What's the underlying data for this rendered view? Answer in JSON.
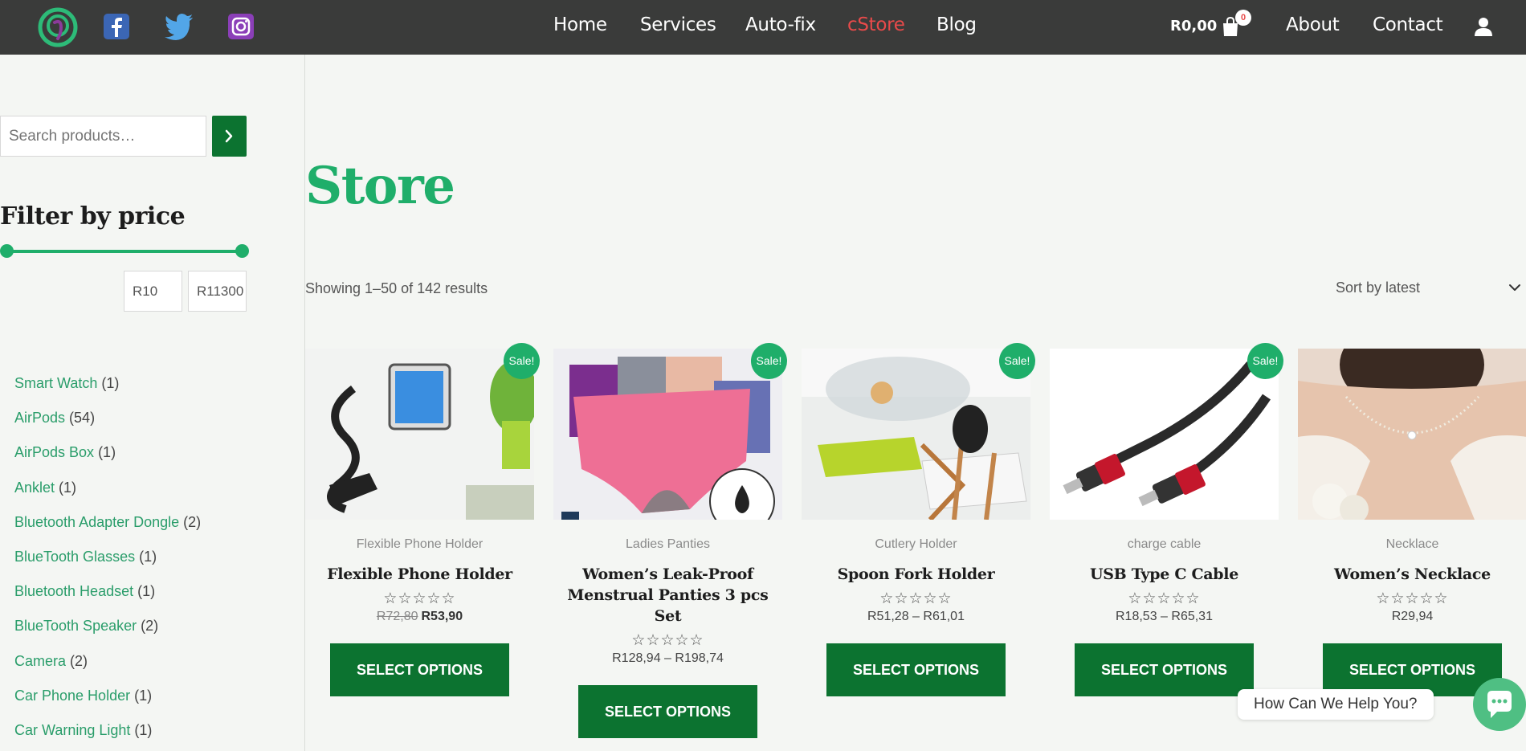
{
  "header": {
    "nav": [
      {
        "label": "Home"
      },
      {
        "label": "Services"
      },
      {
        "label": "Auto-fix"
      },
      {
        "label": "cStore"
      },
      {
        "label": "Blog"
      },
      {
        "label": "About"
      },
      {
        "label": "Contact"
      }
    ],
    "active_nav": "cStore",
    "cart_total": "R0,00",
    "cart_count": "0",
    "social": [
      "facebook-icon",
      "twitter-icon",
      "instagram-icon"
    ]
  },
  "sidebar": {
    "search_placeholder": "Search products…",
    "filter_title": "Filter by price",
    "price_min": "R10",
    "price_max": "R11300",
    "categories": [
      {
        "name": "Smart Watch",
        "count": "(1)"
      },
      {
        "name": "AirPods",
        "count": "(54)"
      },
      {
        "name": "AirPods Box",
        "count": "(1)"
      },
      {
        "name": "Anklet",
        "count": "(1)"
      },
      {
        "name": "Bluetooth Adapter Dongle",
        "count": "(2)"
      },
      {
        "name": "BlueTooth Glasses",
        "count": "(1)"
      },
      {
        "name": "Bluetooth Headset",
        "count": "(1)"
      },
      {
        "name": "BlueTooth Speaker",
        "count": "(2)"
      },
      {
        "name": "Camera",
        "count": "(2)"
      },
      {
        "name": "Car Phone Holder",
        "count": "(1)"
      },
      {
        "name": "Car Warning Light",
        "count": "(1)"
      }
    ]
  },
  "main": {
    "title": "Store",
    "result_count": "Showing 1–50 of 142 results",
    "sort_label": "Sort by latest",
    "sale_label": "Sale!",
    "stars": "☆☆☆☆☆",
    "button_label": "SELECT OPTIONS",
    "products": [
      {
        "category": "Flexible Phone Holder",
        "title": "Flexible Phone Holder",
        "old_price": "R72,80",
        "price": "R53,90",
        "sale": true
      },
      {
        "category": "Ladies Panties",
        "title": "Women’s Leak-Proof Menstrual Panties 3 pcs Set",
        "old_price": "",
        "price": "R128,94 – R198,74",
        "sale": true
      },
      {
        "category": "Cutlery Holder",
        "title": "Spoon Fork Holder",
        "old_price": "",
        "price": "R51,28 – R61,01",
        "sale": true
      },
      {
        "category": "charge cable",
        "title": "USB Type C Cable",
        "old_price": "",
        "price": "R18,53 – R65,31",
        "sale": true
      },
      {
        "category": "Necklace",
        "title": "Women’s Necklace",
        "old_price": "",
        "price": "R29,94",
        "sale": false
      }
    ]
  },
  "chat": {
    "label": "How Can We Help You?"
  },
  "colors": {
    "brand_green": "#1fae6a",
    "button_green": "#0c7330",
    "header_bg": "#3a3b3a",
    "active_nav": "#e84a4a"
  }
}
